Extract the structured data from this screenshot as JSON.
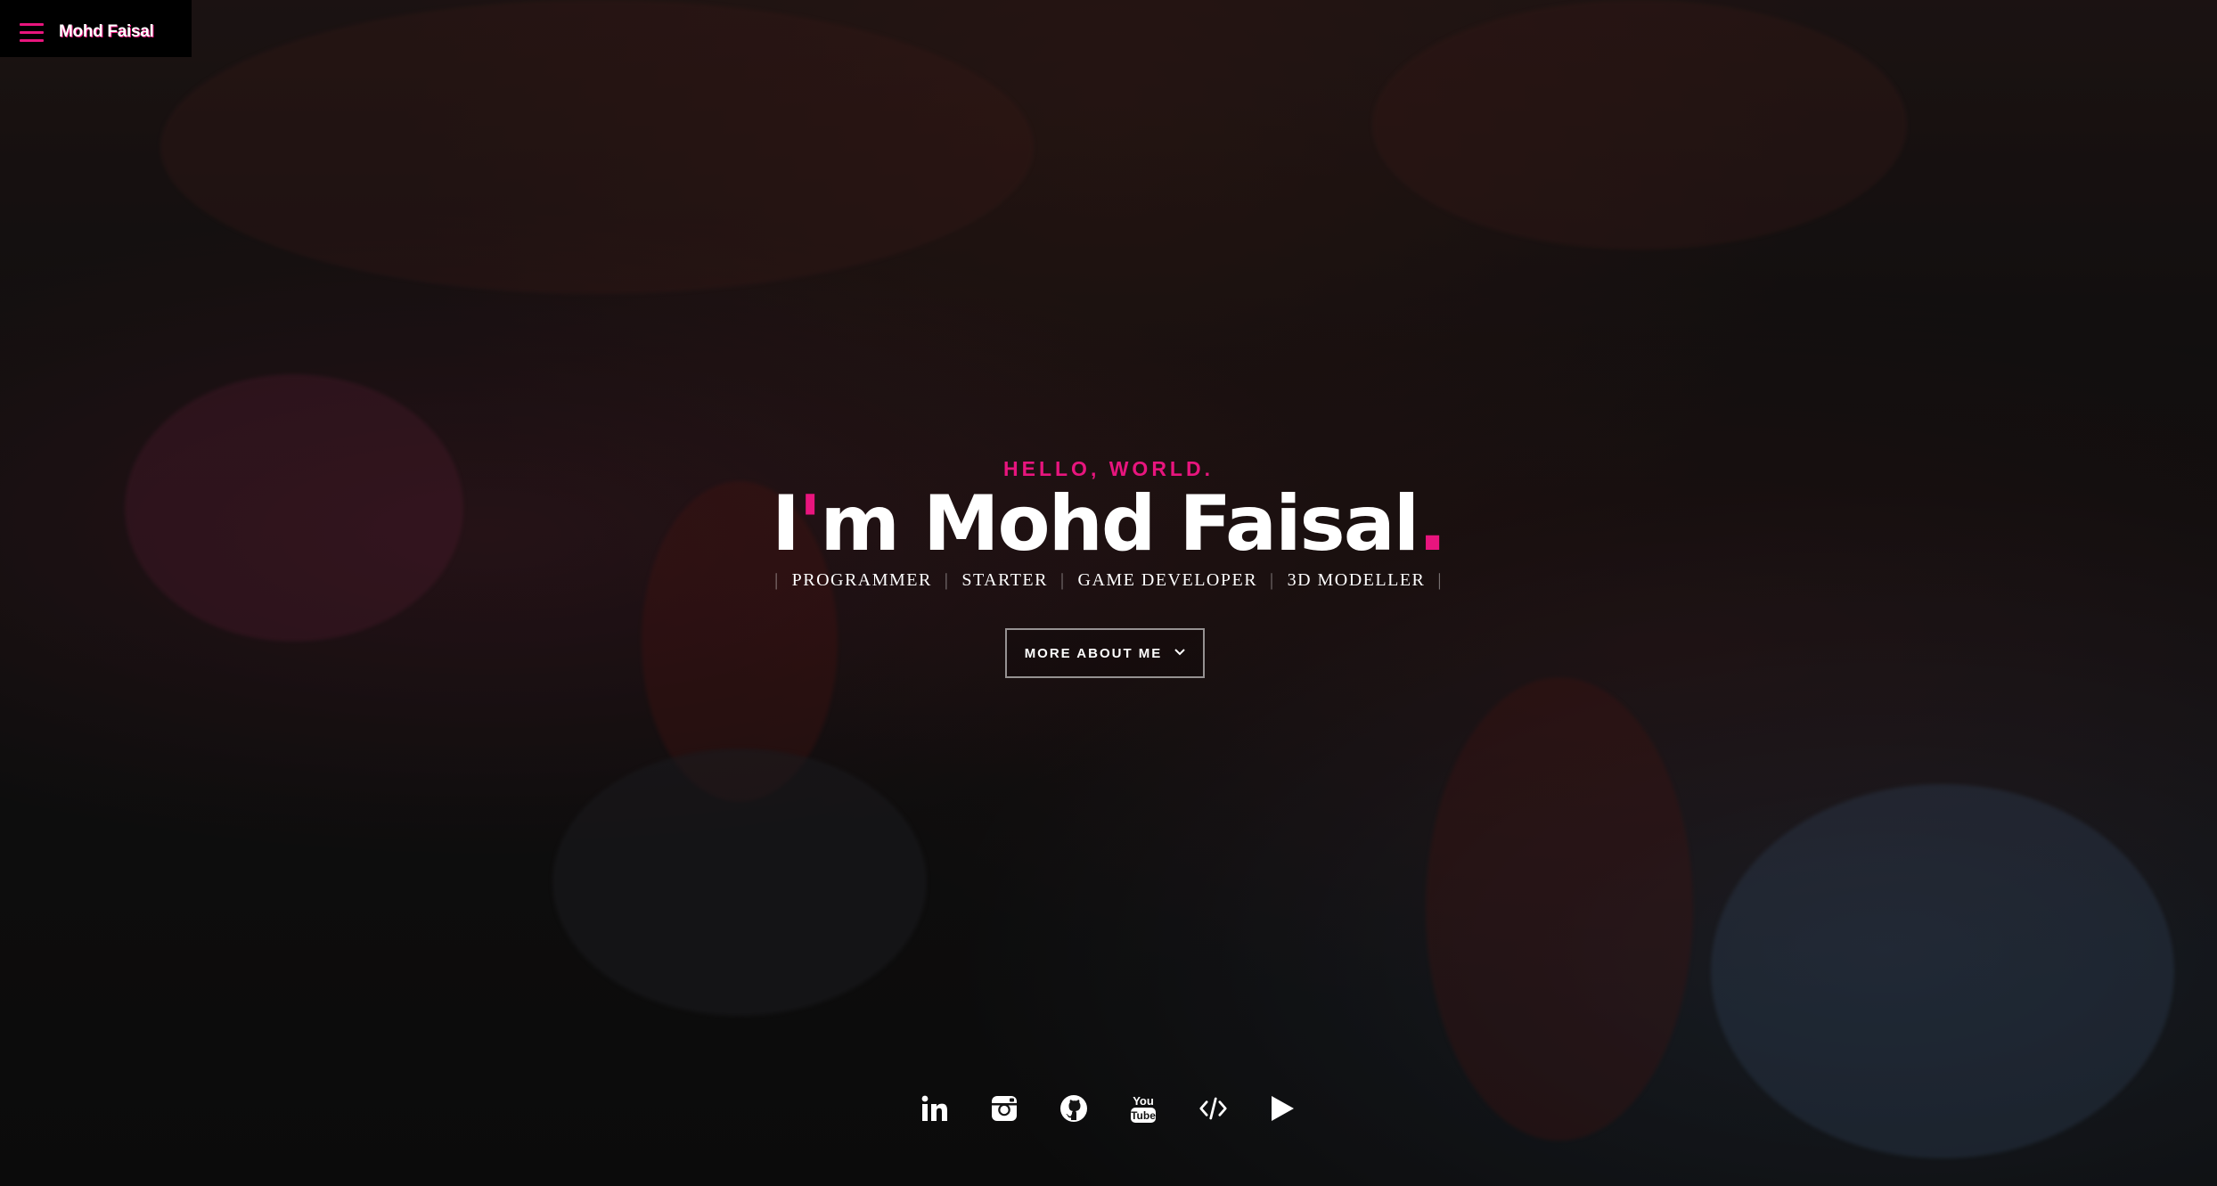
{
  "header": {
    "site_name": "Mohd Faisal"
  },
  "hero": {
    "greeting": "HELLO, WORLD.",
    "headline_prefix": "I",
    "headline_apostrophe": "'",
    "headline_rest": "m Mohd Faisal",
    "headline_period": ".",
    "roles": [
      "PROGRAMMER",
      "STARTER",
      "GAME DEVELOPER",
      "3D MODELLER"
    ],
    "separator": "|",
    "more_button_label": "MORE ABOUT ME"
  },
  "socials": [
    {
      "icon": "linkedin-icon"
    },
    {
      "icon": "instagram-icon"
    },
    {
      "icon": "github-icon"
    },
    {
      "icon": "youtube-icon"
    },
    {
      "icon": "code-icon"
    },
    {
      "icon": "play-icon"
    }
  ],
  "colors": {
    "accent": "#e8157e",
    "text": "#ffffff",
    "menu_bg": "#000000"
  }
}
